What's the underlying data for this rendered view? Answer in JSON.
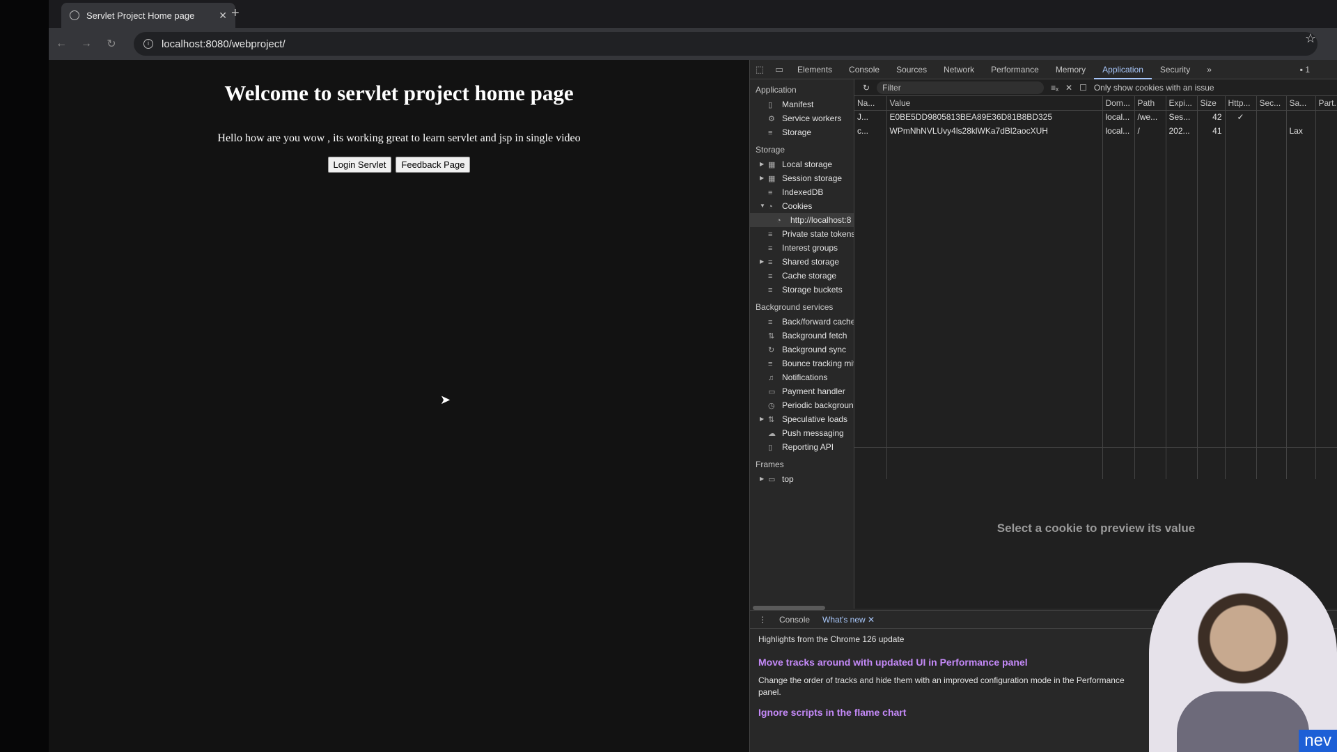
{
  "browser": {
    "tab_title": "Servlet Project Home page",
    "url": "localhost:8080/webproject/"
  },
  "page": {
    "heading": "Welcome to servlet project home page",
    "lead": "Hello how are you wow , its working great to learn servlet and jsp in single video",
    "buttons": [
      "Login Servlet",
      "Feedback Page"
    ]
  },
  "devtools": {
    "tabs": [
      "Elements",
      "Console",
      "Sources",
      "Network",
      "Performance",
      "Memory",
      "Application",
      "Security"
    ],
    "active_tab": "Application",
    "issues_count": "1",
    "sidebar": {
      "application_label": "Application",
      "application_items": [
        "Manifest",
        "Service workers",
        "Storage"
      ],
      "storage_label": "Storage",
      "storage_items": [
        "Local storage",
        "Session storage",
        "IndexedDB",
        "Cookies",
        "http://localhost:8",
        "Private state tokens",
        "Interest groups",
        "Shared storage",
        "Cache storage",
        "Storage buckets"
      ],
      "bg_label": "Background services",
      "bg_items": [
        "Back/forward cache",
        "Background fetch",
        "Background sync",
        "Bounce tracking mitigations",
        "Notifications",
        "Payment handler",
        "Periodic background sync",
        "Speculative loads",
        "Push messaging",
        "Reporting API"
      ],
      "frames_label": "Frames",
      "frames_items": [
        "top"
      ]
    },
    "cookies": {
      "filter_placeholder": "Filter",
      "only_issue_label": "Only show cookies with an issue",
      "columns": [
        "Na...",
        "Value",
        "Dom...",
        "Path",
        "Expi...",
        "Size",
        "Http...",
        "Sec...",
        "Sa...",
        "Part..."
      ],
      "rows": [
        [
          "J...",
          "E0BE5DD9805813BEA89E36D81B8BD325",
          "local...",
          "/we...",
          "Ses...",
          "42",
          "✓",
          "",
          "",
          ""
        ],
        [
          "c...",
          "WPmNhNVLUvy4ls28klWKa7dBl2aocXUH",
          "local...",
          "/",
          "202...",
          "41",
          "",
          "",
          "Lax",
          ""
        ]
      ],
      "preview_text": "Select a cookie to preview its value"
    },
    "drawer": {
      "tabs": [
        "Console",
        "What's new"
      ],
      "subtitle": "Highlights from the Chrome 126 update",
      "h1": "Move tracks around with updated UI in Performance panel",
      "p1": "Change the order of tracks and hide them with an improved configuration mode in the Performance panel.",
      "h2": "Ignore scripts in the flame chart"
    }
  },
  "webcam": {
    "brand_text": "nev"
  }
}
